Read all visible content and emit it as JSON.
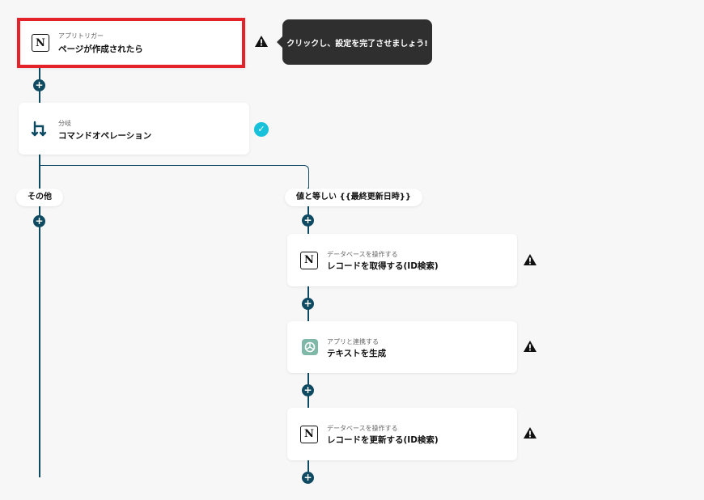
{
  "trigger": {
    "subtitle": "アプリトリガー",
    "title": "ページが作成されたら",
    "icon": "notion-icon"
  },
  "tooltip": {
    "text": "クリックし、設定を完了させましょう!"
  },
  "branch": {
    "subtitle": "分岐",
    "title": "コマンドオペレーション",
    "icon": "branch-icon"
  },
  "branch_labels": {
    "other": "その他",
    "equals": "値と等しい {{最終更新日時}}"
  },
  "steps": [
    {
      "subtitle": "データベースを操作する",
      "title": "レコードを取得する(ID検索)",
      "icon": "notion-icon"
    },
    {
      "subtitle": "アプリと連携する",
      "title": "テキストを生成",
      "icon": "openai-icon"
    },
    {
      "subtitle": "データベースを操作する",
      "title": "レコードを更新する(ID検索)",
      "icon": "notion-icon"
    }
  ],
  "colors": {
    "line": "#0f4a63",
    "highlight": "#e3222a",
    "check": "#17c1d9",
    "tooltip_bg": "#2f2f2f"
  },
  "icons": {
    "plus": "+",
    "check": "✓",
    "notion_glyph": "N"
  }
}
